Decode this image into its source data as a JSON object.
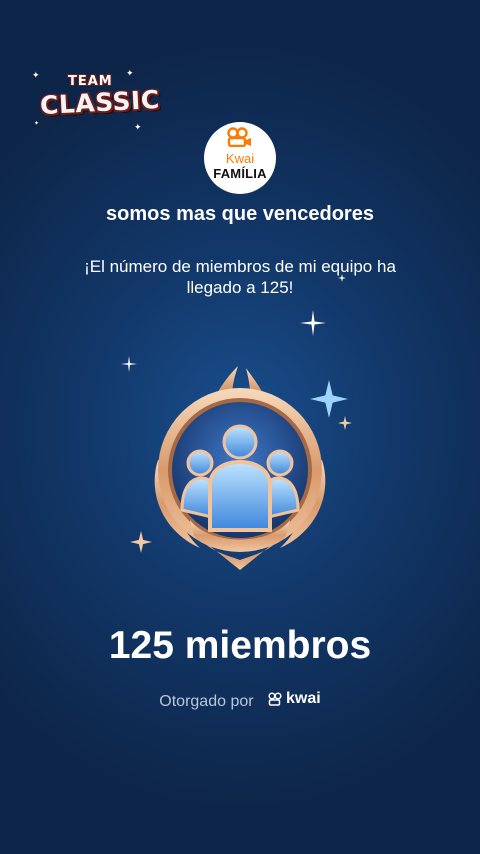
{
  "logo": {
    "team": "TEAM",
    "classic": "CLASSIC"
  },
  "avatar": {
    "brand": "Kwai",
    "family": "FAMÍLIA"
  },
  "group_name": "somos mas que vencedores",
  "message": "¡El número de miembros de mi equipo ha llegado a 125!",
  "members_count_label": "125 miembros",
  "members_count": 125,
  "awarded_by": {
    "prefix": "Otorgado por",
    "brand": "kwai"
  },
  "colors": {
    "background": "#12386a",
    "badge_gold": "#e6b38a",
    "kwai_orange": "#ff7a00"
  },
  "icons": [
    "team-classic-logo",
    "kwai-familia-avatar",
    "members-badge-icon",
    "kwai-logo-icon",
    "sparkle-icon"
  ]
}
